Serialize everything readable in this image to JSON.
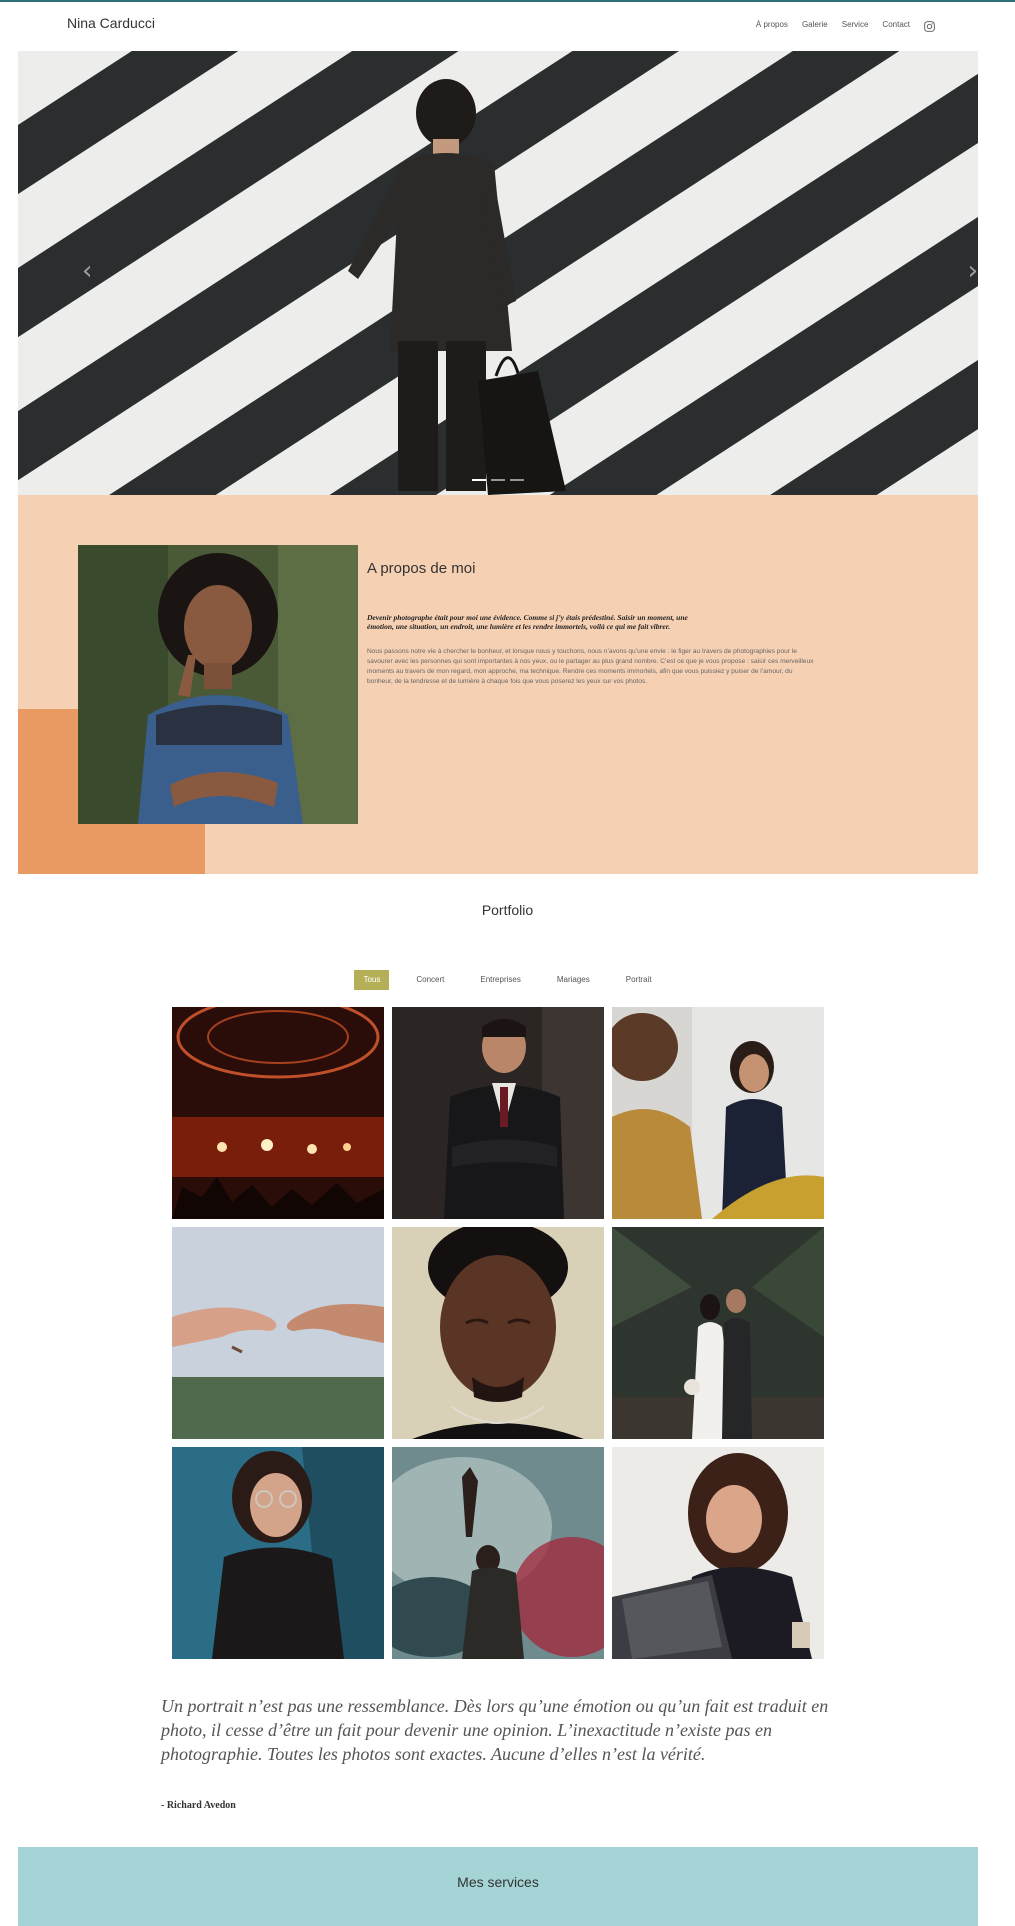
{
  "header": {
    "brand": "Nina Carducci",
    "nav": [
      "À propos",
      "Galerie",
      "Service",
      "Contact"
    ],
    "social_icon": "instagram-icon"
  },
  "hero": {
    "slides_count": 3,
    "active_slide": 1,
    "prev_icon": "chevron-left-icon",
    "next_icon": "chevron-right-icon"
  },
  "about": {
    "title": "A propos de moi",
    "lead": "Devenir photographe était pour moi une évidence. Comme si j’y étais prédestiné. Saisir un moment, une émotion, une situation, un endroit, une lumière et les rendre immortels, voilà ce qui me fait vibrer.",
    "body": "Nous passons notre vie à chercher le bonheur, et lorsque nous y touchons, nous n’avons qu’une envie : le figer au travers de photographies pour le savourer avec les personnes qui sont importantes à nos yeux, ou le partager au plus grand nombre. C’est ce que je vous propose : saisir ces merveilleux moments au travers de mon regard, mon approche, ma technique. Rendre ces moments immortels, afin que vous puissiez y puiser de l’amour, du bonheur, de la tendresse et de lumière à chaque fois que vous poserez les yeux sur vos photos."
  },
  "portfolio": {
    "title": "Portfolio",
    "filters": [
      "Tous",
      "Concert",
      "Entreprises",
      "Mariages",
      "Portrait"
    ],
    "active_filter": "Tous"
  },
  "quote": {
    "text": "Un portrait n’est pas une ressemblance. Dès lors qu’une émotion ou qu’un fait est traduit en photo, il cesse d’être un fait pour devenir une opinion. L’inexactitude n’existe pas en photographie. Toutes les photos sont exactes. Aucune d’elles n’est la vérité.",
    "author": "- Richard Avedon"
  },
  "services": {
    "title": "Mes services"
  },
  "colors": {
    "about_bg": "#f6d0b3",
    "about_accent": "#e99a63",
    "filter_active": "#b5b058",
    "services_bg": "#a5d4d6",
    "top_line": "#2f6f7a"
  }
}
